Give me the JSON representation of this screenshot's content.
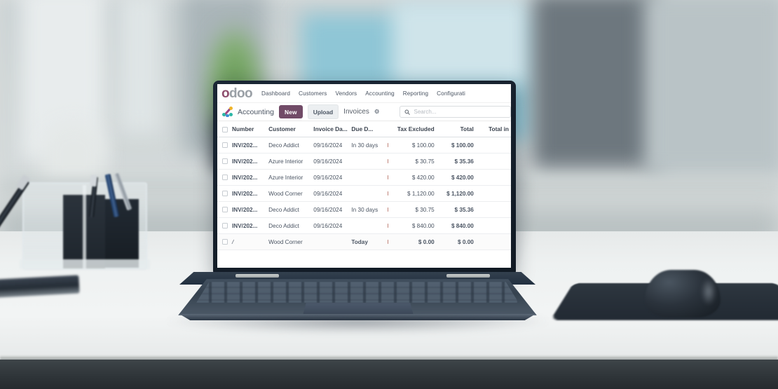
{
  "app": {
    "logo_text_primary": "o",
    "logo_text_rest": "doo",
    "app_name": "Accounting",
    "app_icon": "accounting-app-icon"
  },
  "navbar": {
    "items": [
      {
        "label": "Dashboard"
      },
      {
        "label": "Customers"
      },
      {
        "label": "Vendors"
      },
      {
        "label": "Accounting"
      },
      {
        "label": "Reporting"
      },
      {
        "label": "Configurati"
      }
    ]
  },
  "controlbar": {
    "new_label": "New",
    "upload_label": "Upload",
    "breadcrumb": "Invoices",
    "gear_glyph": "⚙",
    "search_placeholder": "Search...",
    "search_value": ""
  },
  "colors": {
    "odoo_primary": "#714b67",
    "logo_purple": "#8f4f6e",
    "logo_gray": "#9aa0a6",
    "link_teal": "#0e7c86",
    "due_today_orange": "#b5790f",
    "upload_bg": "#eceff1"
  },
  "table": {
    "columns": [
      {
        "key": "check",
        "label": ""
      },
      {
        "key": "number",
        "label": "Number"
      },
      {
        "key": "customer",
        "label": "Customer"
      },
      {
        "key": "invdate",
        "label": "Invoice Da..."
      },
      {
        "key": "duedate",
        "label": "Due D..."
      },
      {
        "key": "activity",
        "label": ""
      },
      {
        "key": "tax",
        "label": "Tax Excluded"
      },
      {
        "key": "total",
        "label": "Total"
      },
      {
        "key": "totalin",
        "label": "Total in"
      }
    ],
    "rows": [
      {
        "number": "INV/202...",
        "customer": "Deco Addict",
        "invdate": "09/16/2024",
        "duedate": "In 30 days",
        "tax": "$ 100.00",
        "total": "$ 100.00",
        "totalin": ""
      },
      {
        "number": "INV/202...",
        "customer": "Azure Interior",
        "invdate": "09/16/2024",
        "duedate": "",
        "tax": "$ 30.75",
        "total": "$ 35.36",
        "totalin": ""
      },
      {
        "number": "INV/202...",
        "customer": "Azure Interior",
        "invdate": "09/16/2024",
        "duedate": "",
        "tax": "$ 420.00",
        "total": "$ 420.00",
        "totalin": ""
      },
      {
        "number": "INV/202...",
        "customer": "Wood Corner",
        "invdate": "09/16/2024",
        "duedate": "",
        "tax": "$ 1,120.00",
        "total": "$ 1,120.00",
        "totalin": ""
      },
      {
        "number": "INV/202...",
        "customer": "Deco Addict",
        "invdate": "09/16/2024",
        "duedate": "In 30 days",
        "tax": "$ 30.75",
        "total": "$ 35.36",
        "totalin": ""
      },
      {
        "number": "INV/202...",
        "customer": "Deco Addict",
        "invdate": "09/16/2024",
        "duedate": "",
        "tax": "$ 840.00",
        "total": "$ 840.00",
        "totalin": ""
      }
    ],
    "new_row": {
      "number": "/",
      "customer": "Wood Corner",
      "invdate": "",
      "duedate": "Today",
      "tax": "$ 0.00",
      "total": "$ 0.00",
      "totalin": ""
    }
  }
}
